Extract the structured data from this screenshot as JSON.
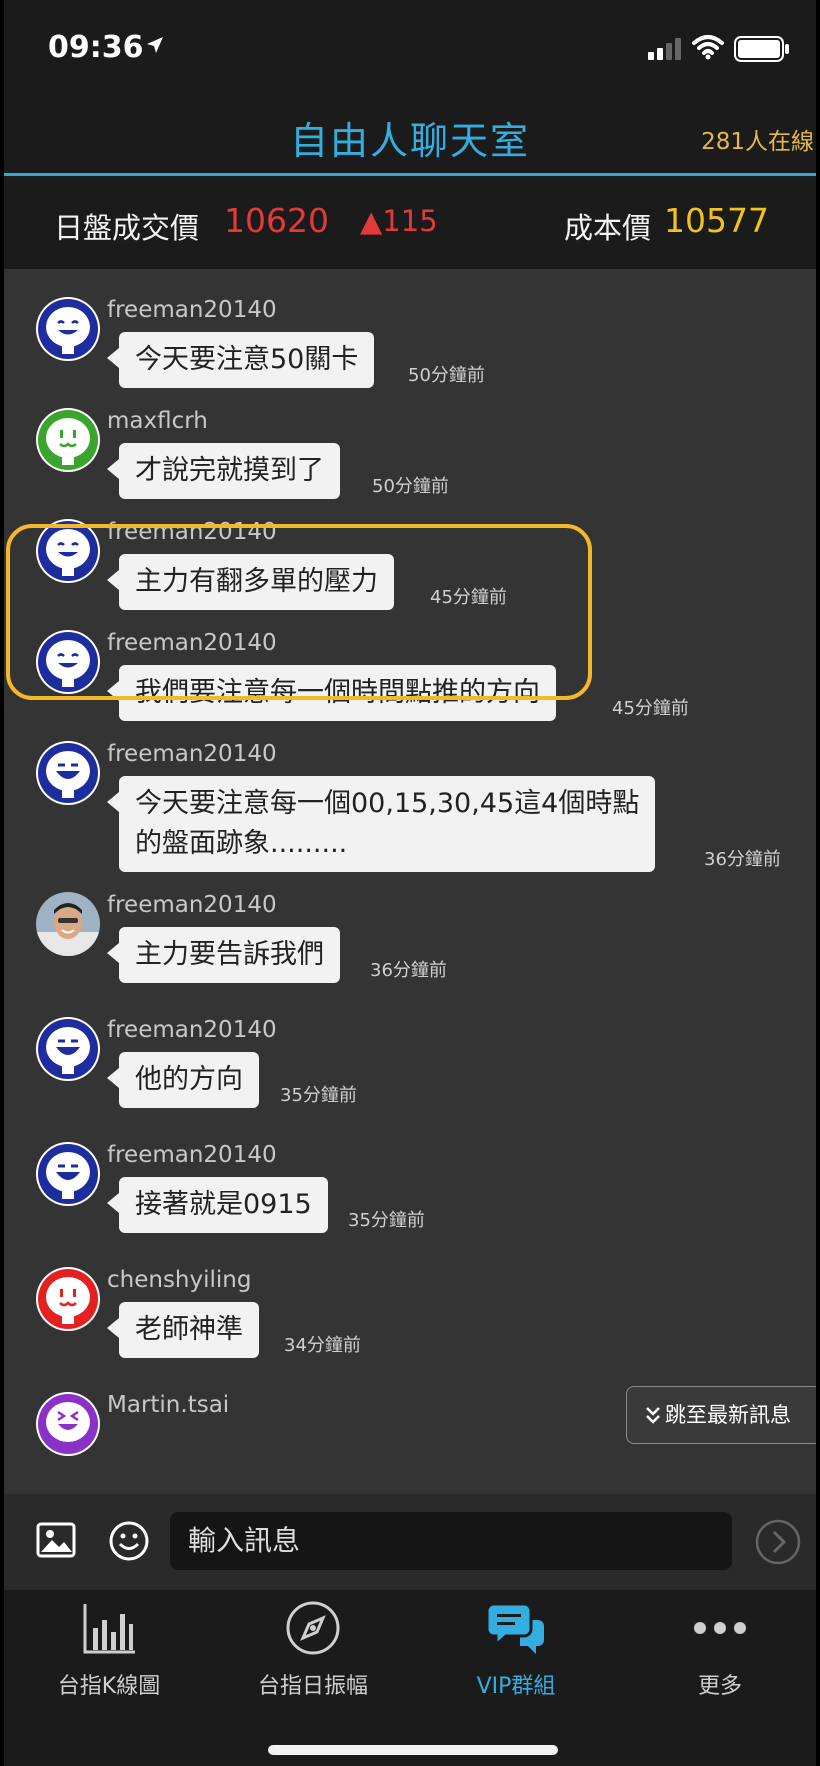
{
  "status_bar": {
    "time": "09:36"
  },
  "header": {
    "title": "自由人聊天室",
    "online": "281人在線"
  },
  "ticker": {
    "price_label": "日盤成交價",
    "price": "10620",
    "change": "▲115",
    "cost_label": "成本價",
    "cost": "10577"
  },
  "messages": [
    {
      "user": "freeman20140",
      "text": "今天要注意50關卡",
      "ago": "50分鐘前",
      "avatar": "blue-smile-icon"
    },
    {
      "user": "maxflcrh",
      "text": "才說完就摸到了",
      "ago": "50分鐘前",
      "avatar": "green-smile-icon"
    },
    {
      "user": "freeman20140",
      "text": "主力有翻多單的壓力",
      "ago": "45分鐘前",
      "avatar": "blue-smile-icon"
    },
    {
      "user": "freeman20140",
      "text": "我們要注意每一個時間點推的方向",
      "ago": "45分鐘前",
      "avatar": "blue-smile-icon"
    },
    {
      "user": "freeman20140",
      "text": "今天要注意每一個00,15,30,45這4個時點\n的盤面跡象.........",
      "ago": "36分鐘前",
      "avatar": "blue-laugh-icon"
    },
    {
      "user": "freeman20140",
      "text": "主力要告訴我們",
      "ago": "36分鐘前",
      "avatar": "user-photo-avatar"
    },
    {
      "user": "freeman20140",
      "text": "他的方向",
      "ago": "35分鐘前",
      "avatar": "blue-laugh-icon"
    },
    {
      "user": "freeman20140",
      "text": "接著就是0915",
      "ago": "35分鐘前",
      "avatar": "blue-laugh-icon"
    },
    {
      "user": "chenshyiling",
      "text": "老師神準",
      "ago": "34分鐘前",
      "avatar": "red-smile-icon"
    },
    {
      "user": "Martin.tsai",
      "text": "",
      "ago": "",
      "avatar": "purple-laugh-icon"
    }
  ],
  "jump_button": "跳至最新訊息",
  "input": {
    "placeholder": "輸入訊息"
  },
  "nav": [
    {
      "label": "台指K線圖",
      "icon": "bar-chart-icon"
    },
    {
      "label": "台指日振幅",
      "icon": "compass-icon"
    },
    {
      "label": "VIP群組",
      "icon": "chat-bubbles-icon"
    },
    {
      "label": "更多",
      "icon": "more-dots-icon"
    }
  ],
  "colors": {
    "accent": "#34aee0",
    "online": "#e4b84a",
    "price": "#e23a3a",
    "cost": "#f0c419",
    "highlight": "#f5b82b"
  }
}
